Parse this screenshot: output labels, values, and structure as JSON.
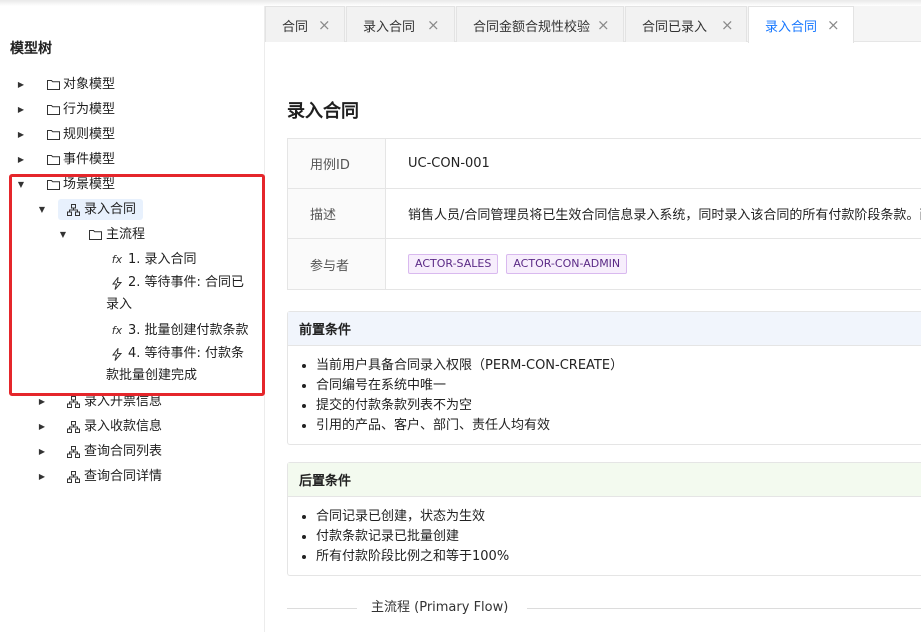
{
  "sidebar": {
    "title": "模型树",
    "items": [
      {
        "label": "对象模型"
      },
      {
        "label": "行为模型"
      },
      {
        "label": "规则模型"
      },
      {
        "label": "事件模型"
      },
      {
        "label": "场景模型"
      },
      {
        "label": "录入合同"
      },
      {
        "label": "主流程"
      },
      {
        "label": "1. 录入合同"
      },
      {
        "label": "2. 等待事件: 合同已录入"
      },
      {
        "label": "3. 批量创建付款条款"
      },
      {
        "label": "4. 等待事件: 付款条款批量创建完成"
      },
      {
        "label": "录入开票信息"
      },
      {
        "label": "录入收款信息"
      },
      {
        "label": "查询合同列表"
      },
      {
        "label": "查询合同详情"
      }
    ]
  },
  "tabs": [
    {
      "label": "合同",
      "close": "×"
    },
    {
      "label": "录入合同",
      "close": "×"
    },
    {
      "label": "合同金额合规性校验",
      "close": "×"
    },
    {
      "label": "合同已录入",
      "close": "×"
    },
    {
      "label": "录入合同",
      "close": "×",
      "active": true
    }
  ],
  "main": {
    "title": "录入合同",
    "info": [
      {
        "key": "用例ID",
        "value": "UC-CON-001"
      },
      {
        "key": "描述",
        "value": "销售人员/合同管理员将已生效合同信息录入系统，同时录入该合同的所有付款阶段条款。两"
      },
      {
        "key": "参与者",
        "tags": [
          "ACTOR-SALES",
          "ACTOR-CON-ADMIN"
        ]
      }
    ],
    "pre": {
      "title": "前置条件",
      "items": [
        "当前用户具备合同录入权限（PERM-CON-CREATE）",
        "合同编号在系统中唯一",
        "提交的付款条款列表不为空",
        "引用的产品、客户、部门、责任人均有效"
      ]
    },
    "post": {
      "title": "后置条件",
      "items": [
        "合同记录已创建，状态为生效",
        "付款条款记录已批量创建",
        "所有付款阶段比例之和等于100%"
      ]
    },
    "flow_title": "主流程 (Primary Flow)"
  },
  "colors": {
    "accent": "#1677ff",
    "highlight": "#e5262b",
    "tag_text": "#5b2a86"
  }
}
